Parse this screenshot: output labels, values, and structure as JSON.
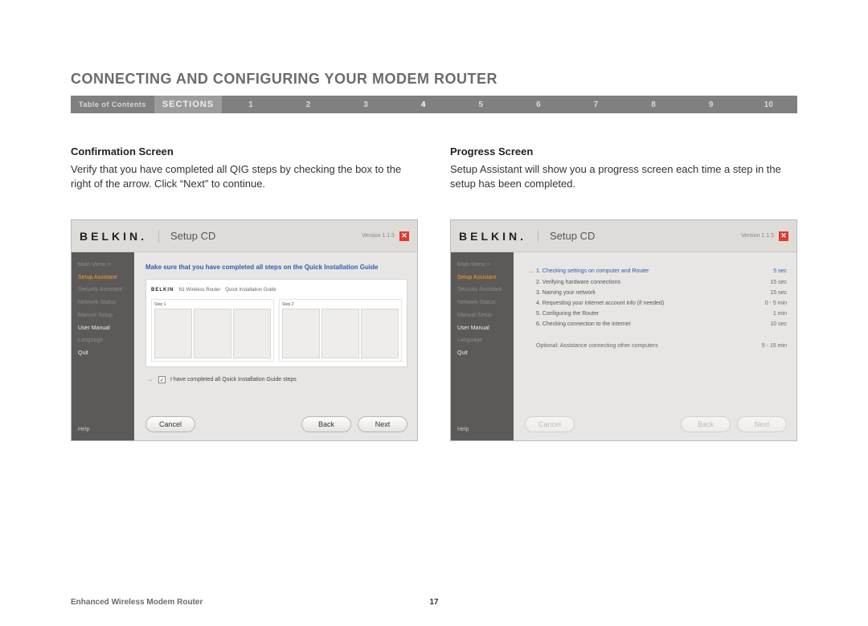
{
  "page_title": "CONNECTING AND CONFIGURING YOUR MODEM ROUTER",
  "nav": {
    "toc": "Table of Contents",
    "sections_label": "SECTIONS",
    "items": [
      "1",
      "2",
      "3",
      "4",
      "5",
      "6",
      "7",
      "8",
      "9",
      "10"
    ],
    "active_index": 3
  },
  "left": {
    "heading": "Confirmation Screen",
    "body": "Verify that you have completed all QIG steps by checking the box to the right of the arrow. Click “Next” to continue."
  },
  "right": {
    "heading": "Progress Screen",
    "body": "Setup Assistant will show you a progress screen each time a step in the setup has been completed."
  },
  "shot_common": {
    "brand": "BELKIN.",
    "title": "Setup CD",
    "version": "Version 1.1.5",
    "close": "✕",
    "sidebar": {
      "mainmenu": "Main Menu  >",
      "setup": "Setup Assistant",
      "security": "Security Assistant",
      "network": "Network Status",
      "manual": "Manual Setup",
      "usermanual": "User Manual",
      "language": "Language",
      "quit": "Quit",
      "help": "Help"
    },
    "buttons": {
      "cancel": "Cancel",
      "back": "Back",
      "next": "Next"
    }
  },
  "shot_confirm": {
    "instruction": "Make sure that you have completed all steps on the Quick Installation Guide",
    "qig_brand": "BELKIN",
    "qig_product": "N1 Wireless Router",
    "qig_guide": "Quick Installation Guide",
    "step1": "Step 1",
    "step2": "Step 2",
    "confirm_text": "I have completed all Quick Installation Guide steps",
    "check_mark": "✓"
  },
  "shot_progress": {
    "steps": [
      {
        "label": "1. Checking settings on computer and Router",
        "time": "5 sec",
        "active": true
      },
      {
        "label": "2. Verifying hardware connections",
        "time": "15 sec",
        "active": false
      },
      {
        "label": "3. Naming your network",
        "time": "15 sec",
        "active": false
      },
      {
        "label": "4. Requesting your internet account info (if needed)",
        "time": "0 - 5 min",
        "active": false
      },
      {
        "label": "5. Configuring the Router",
        "time": "1 min",
        "active": false
      },
      {
        "label": "6. Checking connection to the internet",
        "time": "10 sec",
        "active": false
      }
    ],
    "optional_label": "Optional: Assistance connecting other computers",
    "optional_time": "5 - 15 min"
  },
  "footer": {
    "title": "Enhanced Wireless Modem Router",
    "page": "17"
  }
}
